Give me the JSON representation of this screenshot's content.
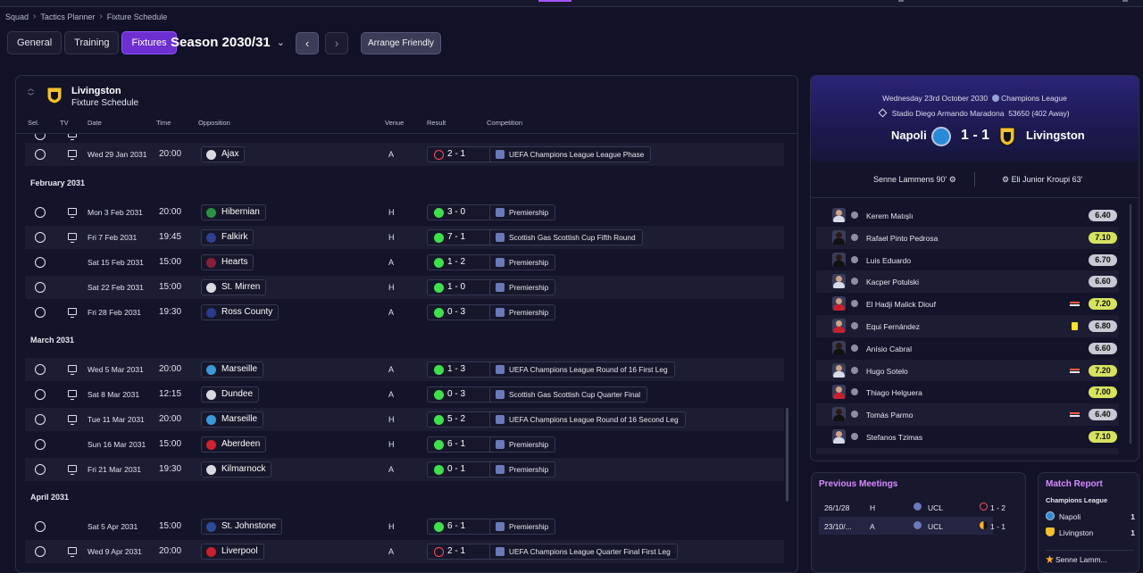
{
  "breadcrumb": [
    "Squad",
    "Tactics Planner",
    "Fixture Schedule"
  ],
  "tabs": [
    "General",
    "Training",
    "Fixtures"
  ],
  "active_tab": "Fixtures",
  "season": "Season 2030/31",
  "arrange_friendly": "Arrange Friendly",
  "club": {
    "name": "Livingston",
    "subtitle": "Fixture Schedule"
  },
  "columns": {
    "sel": "Sel.",
    "tv": "TV",
    "date": "Date",
    "time": "Time",
    "opposition": "Opposition",
    "venue": "Venue",
    "result": "Result",
    "competition": "Competition"
  },
  "months": [
    "February 2031",
    "March 2031",
    "April 2031"
  ],
  "fixtures": [
    {
      "date": "Wed 29 Jan 2031",
      "time": "20:00",
      "opponent": "Ajax",
      "venue": "A",
      "result": "2 - 1",
      "outcome": "loss",
      "competition": "UEFA Champions League League Phase",
      "tv": true,
      "crest_color": "#d9d9e0"
    },
    {
      "date": "Mon 3 Feb 2031",
      "time": "20:00",
      "opponent": "Hibernian",
      "venue": "H",
      "result": "3 - 0",
      "outcome": "win",
      "competition": "Premiership",
      "tv": true,
      "crest_color": "#2e8f45"
    },
    {
      "date": "Fri 7 Feb 2031",
      "time": "19:45",
      "opponent": "Falkirk",
      "venue": "H",
      "result": "7 - 1",
      "outcome": "win",
      "competition": "Scottish Gas Scottish Cup Fifth Round",
      "tv": true,
      "crest_color": "#2e3f8f"
    },
    {
      "date": "Sat 15 Feb 2031",
      "time": "15:00",
      "opponent": "Hearts",
      "venue": "A",
      "result": "1 - 2",
      "outcome": "win",
      "competition": "Premiership",
      "tv": false,
      "crest_color": "#8a1f3a"
    },
    {
      "date": "Sat 22 Feb 2031",
      "time": "15:00",
      "opponent": "St. Mirren",
      "venue": "H",
      "result": "1 - 0",
      "outcome": "win",
      "competition": "Premiership",
      "tv": false,
      "crest_color": "#d9d9e0"
    },
    {
      "date": "Fri 28 Feb 2031",
      "time": "19:30",
      "opponent": "Ross County",
      "venue": "A",
      "result": "0 - 3",
      "outcome": "win",
      "competition": "Premiership",
      "tv": true,
      "crest_color": "#2a3a8c"
    },
    {
      "date": "Wed 5 Mar 2031",
      "time": "20:00",
      "opponent": "Marseille",
      "venue": "A",
      "result": "1 - 3",
      "outcome": "win",
      "competition": "UEFA Champions League Round of 16  First Leg",
      "tv": true,
      "crest_color": "#3a9ad9"
    },
    {
      "date": "Sat 8 Mar 2031",
      "time": "12:15",
      "opponent": "Dundee",
      "venue": "A",
      "result": "0 - 3",
      "outcome": "win",
      "competition": "Scottish Gas Scottish Cup Quarter Final",
      "tv": true,
      "crest_color": "#d9d9e0"
    },
    {
      "date": "Tue 11 Mar 2031",
      "time": "20:00",
      "opponent": "Marseille",
      "venue": "H",
      "result": "5 - 2",
      "outcome": "win",
      "competition": "UEFA Champions League Round of 16  Second Leg",
      "tv": true,
      "crest_color": "#3a9ad9"
    },
    {
      "date": "Sun 16 Mar 2031",
      "time": "15:00",
      "opponent": "Aberdeen",
      "venue": "H",
      "result": "6 - 1",
      "outcome": "win",
      "competition": "Premiership",
      "tv": false,
      "crest_color": "#d1222e"
    },
    {
      "date": "Fri 21 Mar 2031",
      "time": "19:30",
      "opponent": "Kilmarnock",
      "venue": "A",
      "result": "0 - 1",
      "outcome": "win",
      "competition": "Premiership",
      "tv": true,
      "crest_color": "#d9d9e0"
    },
    {
      "date": "Sat 5 Apr 2031",
      "time": "15:00",
      "opponent": "St. Johnstone",
      "venue": "H",
      "result": "6 - 1",
      "outcome": "win",
      "competition": "Premiership",
      "tv": false,
      "crest_color": "#2a4a9c"
    },
    {
      "date": "Wed 9 Apr 2031",
      "time": "20:00",
      "opponent": "Liverpool",
      "venue": "A",
      "result": "2 - 1",
      "outcome": "loss",
      "competition": "UEFA Champions League Quarter Final First Leg",
      "tv": true,
      "crest_color": "#c7202f"
    }
  ],
  "match": {
    "date": "Wednesday 23rd October 2030",
    "competition": "Champions League",
    "stadium": "Stadio Diego Armando Maradona",
    "attendance": "53650",
    "away_count": "(402 Away)",
    "home_team": "Napoli",
    "score": "1 - 1",
    "away_team": "Livingston",
    "home_scorer": "Senne Lammens 90'",
    "away_scorer": "Eli Junior Kroupi 63'"
  },
  "players": [
    {
      "name": "Kerem Matışlı",
      "rating": "6.40",
      "event": "",
      "good": false,
      "face": ""
    },
    {
      "name": "Rafael Pinto Pedrosa",
      "rating": "7.10",
      "event": "",
      "good": true,
      "face": "dark"
    },
    {
      "name": "Luis Eduardo",
      "rating": "6.70",
      "event": "",
      "good": false,
      "face": "dark"
    },
    {
      "name": "Kacper Potulski",
      "rating": "6.60",
      "event": "",
      "good": false,
      "face": ""
    },
    {
      "name": "El Hadji Malick Diouf",
      "rating": "7.20",
      "event": "sub",
      "good": true,
      "face": "red"
    },
    {
      "name": "Equi Fernández",
      "rating": "6.80",
      "event": "yel",
      "good": false,
      "face": "red"
    },
    {
      "name": "Anísio Cabral",
      "rating": "6.60",
      "event": "",
      "good": false,
      "face": "dark"
    },
    {
      "name": "Hugo Sotelo",
      "rating": "7.20",
      "event": "sub",
      "good": true,
      "face": ""
    },
    {
      "name": "Thiago Helguera",
      "rating": "7.00",
      "event": "",
      "good": true,
      "face": "red"
    },
    {
      "name": "Tomás Parmo",
      "rating": "6.40",
      "event": "sub",
      "good": false,
      "face": "dark"
    },
    {
      "name": "Stefanos Tzimas",
      "rating": "7.10",
      "event": "",
      "good": true,
      "face": ""
    }
  ],
  "previous_meetings": {
    "title": "Previous Meetings",
    "rows": [
      {
        "date": "26/1/28",
        "venue": "H",
        "comp": "UCL",
        "result": "1 - 2",
        "kind": "loss"
      },
      {
        "date": "23/10/...",
        "venue": "A",
        "comp": "UCL",
        "result": "1 - 1",
        "kind": "draw"
      }
    ]
  },
  "match_report": {
    "title": "Match Report",
    "competition": "Champions League",
    "teams": [
      {
        "name": "Napoli",
        "score": "1"
      },
      {
        "name": "Livingston",
        "score": "1"
      }
    ],
    "motm": "Senne Lamm..."
  }
}
